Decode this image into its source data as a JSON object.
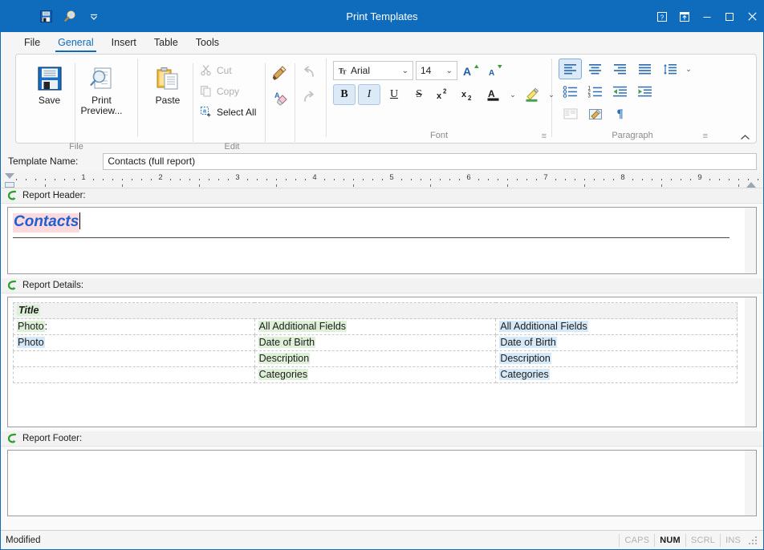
{
  "window": {
    "title": "Print Templates",
    "quick_access": [
      {
        "name": "save",
        "icon": "floppy-disk-icon",
        "tooltip": "Save"
      },
      {
        "name": "print-preview",
        "icon": "magnifier-icon",
        "tooltip": "Print Preview"
      },
      {
        "name": "customize",
        "icon": "chevron-down-icon",
        "tooltip": "Customize Quick Access Toolbar"
      }
    ],
    "controls": [
      {
        "name": "help",
        "glyph": "?"
      },
      {
        "name": "ribbon-display-options",
        "glyph": "ribbon"
      },
      {
        "name": "minimize",
        "glyph": "minimize"
      },
      {
        "name": "maximize",
        "glyph": "maximize"
      },
      {
        "name": "close",
        "glyph": "close"
      }
    ]
  },
  "tabs": [
    {
      "label": "File",
      "active": false
    },
    {
      "label": "General",
      "active": true
    },
    {
      "label": "Insert",
      "active": false
    },
    {
      "label": "Table",
      "active": false
    },
    {
      "label": "Tools",
      "active": false
    }
  ],
  "ribbon": {
    "groups": [
      {
        "name": "file",
        "label": "File",
        "buttons": [
          {
            "label": "Save",
            "icon": "floppy-disk-icon",
            "enabled": true
          },
          {
            "label": "Print Preview...",
            "icon": "print-preview-icon",
            "enabled": true
          }
        ]
      },
      {
        "name": "edit",
        "label": "Edit",
        "buttons": [
          {
            "label": "Paste",
            "icon": "clipboard-icon",
            "enabled": true
          },
          {
            "label": "Cut",
            "icon": "scissors-icon",
            "enabled": false
          },
          {
            "label": "Copy",
            "icon": "copy-icon",
            "enabled": false
          },
          {
            "label": "Select All",
            "icon": "select-all-icon",
            "enabled": true
          },
          {
            "label": "Format Painter",
            "icon": "format-painter-icon",
            "enabled": true
          },
          {
            "label": "Clear Formatting",
            "icon": "clear-formatting-icon",
            "enabled": true
          },
          {
            "label": "Undo",
            "icon": "undo-icon",
            "enabled": false
          },
          {
            "label": "Redo",
            "icon": "redo-icon",
            "enabled": false
          }
        ]
      },
      {
        "name": "font",
        "label": "Font",
        "font_name": "Arial",
        "font_size": "14",
        "buttons": [
          {
            "label": "Grow Font",
            "icon": "grow-font-icon",
            "active": false
          },
          {
            "label": "Shrink Font",
            "icon": "shrink-font-icon",
            "active": false
          },
          {
            "label": "Bold",
            "icon": "bold-icon",
            "glyph": "B",
            "active": true
          },
          {
            "label": "Italic",
            "icon": "italic-icon",
            "glyph": "I",
            "active": true
          },
          {
            "label": "Underline",
            "icon": "underline-icon",
            "glyph": "U",
            "active": false
          },
          {
            "label": "Strikethrough",
            "icon": "strikethrough-icon",
            "glyph": "S",
            "active": false
          },
          {
            "label": "Superscript",
            "icon": "superscript-icon",
            "active": false
          },
          {
            "label": "Subscript",
            "icon": "subscript-icon",
            "active": false
          },
          {
            "label": "Font Color",
            "icon": "font-color-icon",
            "active": false
          },
          {
            "label": "Text Highlight Color",
            "icon": "highlight-icon",
            "active": false
          }
        ]
      },
      {
        "name": "paragraph",
        "label": "Paragraph",
        "buttons": [
          {
            "label": "Align Left",
            "icon": "align-left-icon",
            "active": true
          },
          {
            "label": "Center",
            "icon": "align-center-icon",
            "active": false
          },
          {
            "label": "Align Right",
            "icon": "align-right-icon",
            "active": false
          },
          {
            "label": "Justify",
            "icon": "align-justify-icon",
            "active": false
          },
          {
            "label": "Line Spacing",
            "icon": "line-spacing-icon",
            "active": false
          },
          {
            "label": "Bullets",
            "icon": "bullets-icon",
            "active": false
          },
          {
            "label": "Numbering",
            "icon": "numbering-icon",
            "active": false
          },
          {
            "label": "Decrease Indent",
            "icon": "decrease-indent-icon",
            "active": false
          },
          {
            "label": "Increase Indent",
            "icon": "increase-indent-icon",
            "active": false
          },
          {
            "label": "Borders",
            "icon": "borders-icon",
            "active": false,
            "enabled": false
          },
          {
            "label": "Shading",
            "icon": "shading-icon",
            "active": false
          },
          {
            "label": "Show Formatting Marks",
            "icon": "pilcrow-icon",
            "glyph": "¶",
            "active": false
          }
        ]
      }
    ],
    "collapse_tooltip": "Collapse the Ribbon"
  },
  "template_bar": {
    "label": "Template Name:",
    "value": "Contacts (full report)",
    "placeholder": "Template Name"
  },
  "ruler": {
    "numbers": [
      "1",
      "2",
      "3",
      "4",
      "5",
      "6",
      "7",
      "8",
      "9"
    ],
    "unit": "inch"
  },
  "sections": [
    {
      "name": "report-header",
      "title": "Report Header:",
      "icon": "green-arrow-icon",
      "content": {
        "heading": "Contacts",
        "has_caret": true,
        "has_rule": true
      }
    },
    {
      "name": "report-details",
      "title": "Report Details:",
      "icon": "green-arrow-icon",
      "table": {
        "title_cell": "Title",
        "rows": [
          {
            "col_a": [
              {
                "text": "Photo",
                "highlight": "green"
              },
              {
                "text": ":",
                "highlight": "none"
              }
            ],
            "col_b": {
              "text": "All Additional Fields",
              "highlight": "green"
            },
            "col_c": {
              "text": "All Additional Fields",
              "highlight": "blue"
            }
          },
          {
            "col_a": [
              {
                "text": "Photo",
                "highlight": "blue"
              }
            ],
            "col_b": {
              "text": "Date of Birth",
              "highlight": "green"
            },
            "col_c": {
              "text": "Date of Birth",
              "highlight": "blue"
            }
          },
          {
            "col_a": [],
            "col_b": {
              "text": "Description",
              "highlight": "green"
            },
            "col_c": {
              "text": "Description",
              "highlight": "blue"
            }
          },
          {
            "col_a": [],
            "col_b": {
              "text": "Categories",
              "highlight": "green"
            },
            "col_c": {
              "text": "Categories",
              "highlight": "blue"
            }
          }
        ]
      }
    },
    {
      "name": "report-footer",
      "title": "Report Footer:",
      "icon": "green-arrow-icon",
      "content": {
        "heading": "",
        "has_caret": false,
        "has_rule": false
      }
    }
  ],
  "status": {
    "message": "Modified",
    "indicators": [
      {
        "label": "CAPS",
        "on": false
      },
      {
        "label": "NUM",
        "on": true
      },
      {
        "label": "SCRL",
        "on": false
      },
      {
        "label": "INS",
        "on": false
      }
    ]
  },
  "colors": {
    "accent": "#0f6cbd",
    "heading_text": "#1f5fd0",
    "heading_highlight": "#fadadd",
    "field_green": "#dff0d8",
    "field_blue": "#d6e9f8",
    "section_header_bg": "#f2f2f2"
  }
}
